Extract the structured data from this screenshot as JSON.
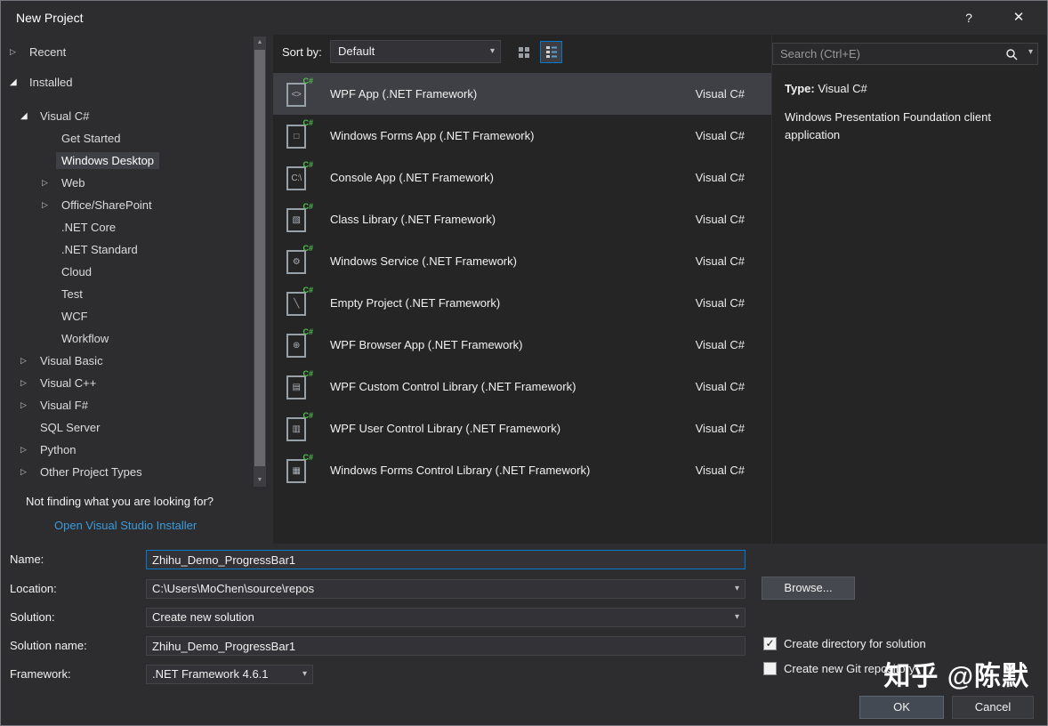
{
  "colors": {
    "accent": "#007acc",
    "link": "#3a9bdc",
    "selection": "#3f3f46",
    "csharp_green": "#51c351",
    "titlebar_background": "#2d2d30",
    "panel_background": "#252526"
  },
  "window": {
    "title": "New Project",
    "help_icon": "?",
    "close_icon": "✕"
  },
  "sidebar": {
    "items": [
      {
        "label": "Recent",
        "indent": 0,
        "arrow": "collapsed",
        "gap_after": 9
      },
      {
        "label": "Installed",
        "indent": 0,
        "arrow": "expanded",
        "gap_after": 13
      },
      {
        "label": "Visual C#",
        "indent": 1,
        "arrow": "expanded"
      },
      {
        "label": "Get Started",
        "indent": 2,
        "arrow": null
      },
      {
        "label": "Windows Desktop",
        "indent": 2,
        "arrow": null,
        "selected": true
      },
      {
        "label": "Web",
        "indent": 2,
        "arrow": "collapsed"
      },
      {
        "label": "Office/SharePoint",
        "indent": 2,
        "arrow": "collapsed"
      },
      {
        "label": ".NET Core",
        "indent": 2,
        "arrow": null
      },
      {
        "label": ".NET Standard",
        "indent": 2,
        "arrow": null
      },
      {
        "label": "Cloud",
        "indent": 2,
        "arrow": null
      },
      {
        "label": "Test",
        "indent": 2,
        "arrow": null
      },
      {
        "label": "WCF",
        "indent": 2,
        "arrow": null
      },
      {
        "label": "Workflow",
        "indent": 2,
        "arrow": null
      },
      {
        "label": "Visual Basic",
        "indent": 1,
        "arrow": "collapsed"
      },
      {
        "label": "Visual C++",
        "indent": 1,
        "arrow": "collapsed"
      },
      {
        "label": "Visual F#",
        "indent": 1,
        "arrow": "collapsed"
      },
      {
        "label": "SQL Server",
        "indent": 1,
        "arrow": null
      },
      {
        "label": "Python",
        "indent": 1,
        "arrow": "collapsed"
      },
      {
        "label": "Other Project Types",
        "indent": 1,
        "arrow": "collapsed"
      }
    ],
    "not_finding_text": "Not finding what you are looking for?",
    "installer_link": "Open Visual Studio Installer"
  },
  "toolbar": {
    "sort_by_label": "Sort by:",
    "sort_value": "Default"
  },
  "search": {
    "placeholder": "Search (Ctrl+E)"
  },
  "template_badge": "C#",
  "templates": [
    {
      "name": "WPF App (.NET Framework)",
      "lang": "Visual C#",
      "icon": "wpf-app-icon",
      "selected": true
    },
    {
      "name": "Windows Forms App (.NET Framework)",
      "lang": "Visual C#",
      "icon": "winforms-app-icon"
    },
    {
      "name": "Console App (.NET Framework)",
      "lang": "Visual C#",
      "icon": "console-app-icon"
    },
    {
      "name": "Class Library (.NET Framework)",
      "lang": "Visual C#",
      "icon": "class-library-icon"
    },
    {
      "name": "Windows Service (.NET Framework)",
      "lang": "Visual C#",
      "icon": "windows-service-icon"
    },
    {
      "name": "Empty Project (.NET Framework)",
      "lang": "Visual C#",
      "icon": "empty-project-icon"
    },
    {
      "name": "WPF Browser App (.NET Framework)",
      "lang": "Visual C#",
      "icon": "wpf-browser-icon"
    },
    {
      "name": "WPF Custom Control Library (.NET Framework)",
      "lang": "Visual C#",
      "icon": "wpf-custom-control-icon"
    },
    {
      "name": "WPF User Control Library (.NET Framework)",
      "lang": "Visual C#",
      "icon": "wpf-user-control-icon"
    },
    {
      "name": "Windows Forms Control Library (.NET Framework)",
      "lang": "Visual C#",
      "icon": "winforms-control-library-icon"
    }
  ],
  "details": {
    "type_label": "Type:",
    "type_value": "Visual C#",
    "description": "Windows Presentation Foundation client application"
  },
  "form": {
    "name_label": "Name:",
    "name_value": "Zhihu_Demo_ProgressBar1",
    "location_label": "Location:",
    "location_value": "C:\\Users\\MoChen\\source\\repos",
    "browse_button": "Browse...",
    "solution_label": "Solution:",
    "solution_value": "Create new solution",
    "solution_name_label": "Solution name:",
    "solution_name_value": "Zhihu_Demo_ProgressBar1",
    "framework_label": "Framework:",
    "framework_value": ".NET Framework 4.6.1",
    "checkbox_directory_label": "Create directory for solution",
    "checkbox_directory_checked": true,
    "checkbox_git_label": "Create new Git repository",
    "checkbox_git_checked": false,
    "ok_button": "OK",
    "cancel_button": "Cancel"
  },
  "watermark": "知乎 @陈默"
}
